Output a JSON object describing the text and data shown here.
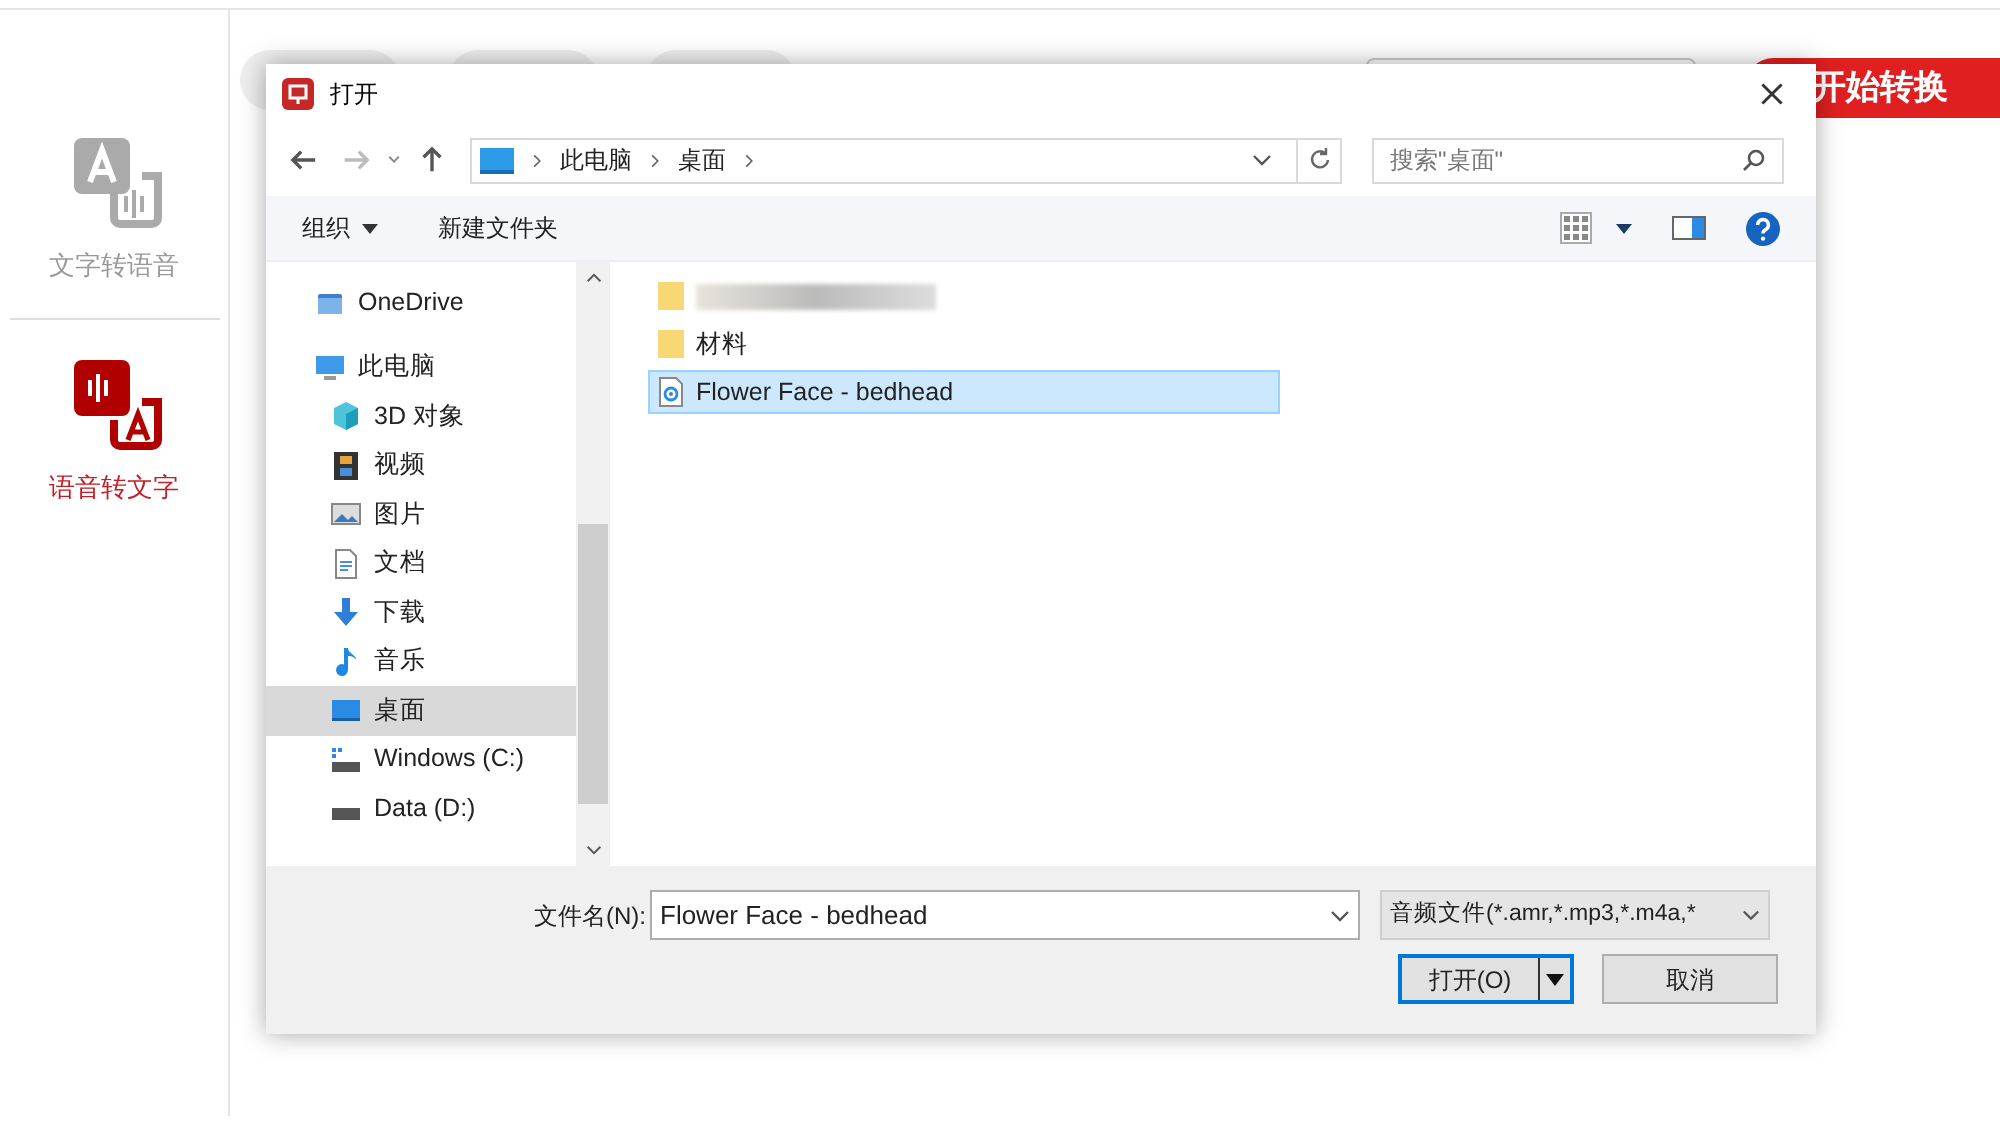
{
  "sidebar": {
    "items": [
      {
        "label": "文字转语音",
        "selected": false
      },
      {
        "label": "语音转文字",
        "selected": true
      }
    ]
  },
  "start_button": "开始转换",
  "dialog": {
    "title": "打开",
    "path": [
      "此电脑",
      "桌面"
    ],
    "search": {
      "placeholder": "搜索\"桌面\""
    },
    "toolbar": {
      "organize": "组织",
      "new_folder": "新建文件夹"
    },
    "nav": [
      {
        "label": "OneDrive",
        "selected": false
      },
      {
        "label": "此电脑",
        "selected": false,
        "children": [
          {
            "label": "3D 对象",
            "selected": false
          },
          {
            "label": "视频",
            "selected": false
          },
          {
            "label": "图片",
            "selected": false
          },
          {
            "label": "文档",
            "selected": false
          },
          {
            "label": "下载",
            "selected": false
          },
          {
            "label": "音乐",
            "selected": false
          },
          {
            "label": "桌面",
            "selected": true
          },
          {
            "label": "Windows (C:)",
            "selected": false
          },
          {
            "label": "Data (D:)",
            "selected": false
          }
        ]
      }
    ],
    "files": [
      {
        "kind": "redacted",
        "selected": false
      },
      {
        "kind": "folder",
        "name": "材料",
        "selected": false
      },
      {
        "kind": "audio",
        "name": "Flower Face - bedhead",
        "selected": true
      }
    ],
    "filename_label": "文件名(N):",
    "filename": "Flower Face - bedhead",
    "filter": "音频文件(*.amr,*.mp3,*.m4a,*",
    "open_button": "打开(O)",
    "cancel_button": "取消"
  }
}
